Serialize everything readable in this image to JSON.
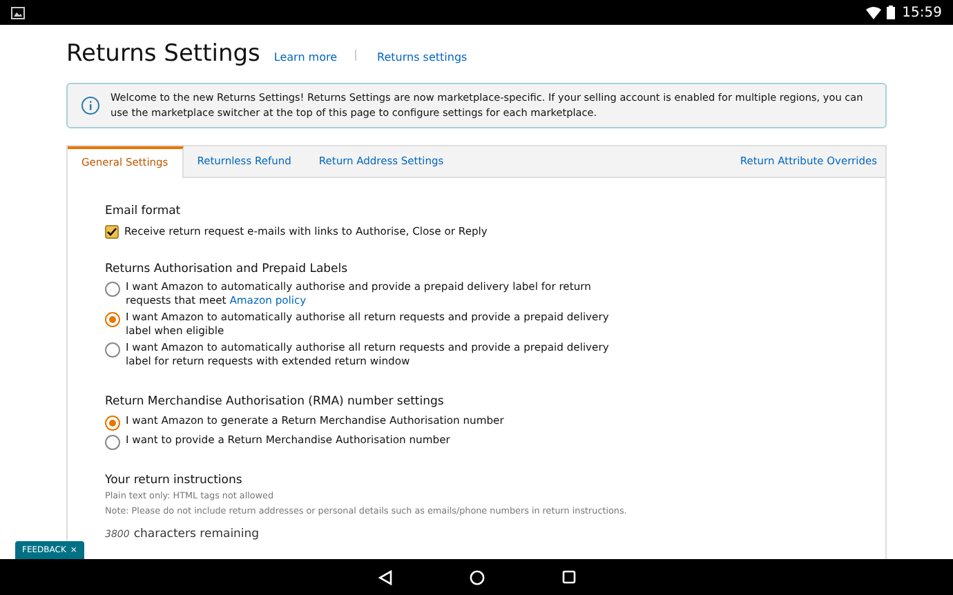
{
  "status_bar": {
    "time": "15:59"
  },
  "header": {
    "title": "Returns Settings",
    "links": [
      "Learn more",
      "Returns settings"
    ]
  },
  "info_banner": {
    "text": "Welcome to the new Returns Settings! Returns Settings are now marketplace-specific. If your selling account is enabled for multiple regions, you can use the marketplace switcher at the top of this page to configure settings for each marketplace."
  },
  "tabs": [
    {
      "label": "General Settings",
      "selected": true
    },
    {
      "label": "Returnless Refund",
      "selected": false
    },
    {
      "label": "Return Address Settings",
      "selected": false
    }
  ],
  "overrides_link": "Return Attribute Overrides",
  "email_format": {
    "heading": "Email format",
    "checkbox": {
      "label": "Receive return request e-mails with links to Authorise, Close or Reply",
      "checked": true
    }
  },
  "authorisation": {
    "heading": "Returns Authorisation and Prepaid Labels",
    "options": [
      {
        "label": "I want Amazon to automatically authorise and provide a prepaid delivery label for return requests that meet",
        "link": "Amazon policy",
        "selected": false
      },
      {
        "label": "I want Amazon to automatically authorise all return requests and provide a prepaid delivery label when eligible",
        "selected": true
      },
      {
        "label": "I want Amazon to automatically authorise all return requests and provide a prepaid delivery label for return requests with extended return window",
        "selected": false
      }
    ]
  },
  "rma": {
    "heading": "Return Merchandise Authorisation (RMA) number settings",
    "options": [
      {
        "label": "I want Amazon to generate a Return Merchandise Authorisation number",
        "selected": true
      },
      {
        "label": "I want to provide a Return Merchandise Authorisation number",
        "selected": false
      }
    ]
  },
  "instructions": {
    "heading": "Your return instructions",
    "hint": "Plain text only: HTML tags not allowed",
    "note": "Note: Please do not include return addresses or personal details such as emails/phone numbers in return instructions.",
    "count": "3800",
    "count_label": "characters remaining"
  },
  "feedback_button": {
    "label": "FEEDBACK",
    "close": "×"
  }
}
